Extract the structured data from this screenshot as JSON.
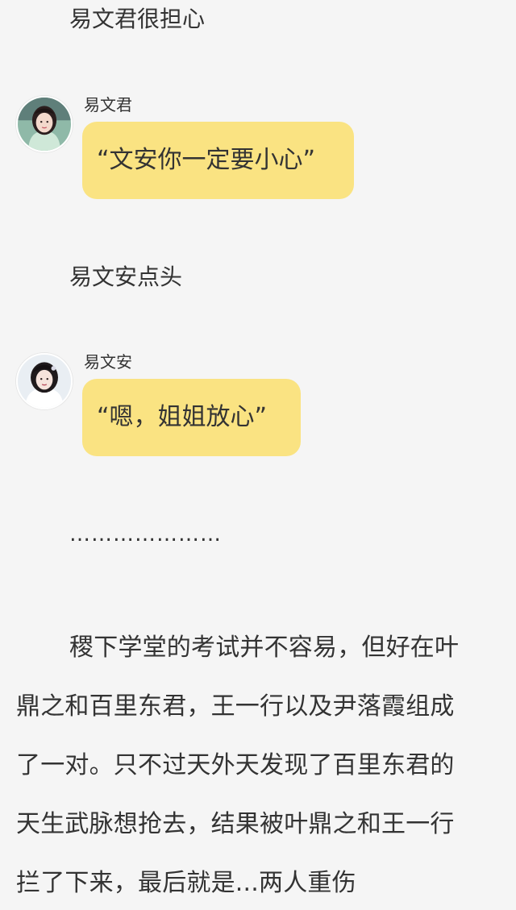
{
  "narration_top": "易文君很担心",
  "chat_1": {
    "avatar": "female-portrait-avatar",
    "speaker": "易文君",
    "message": "“文安你一定要小心”"
  },
  "narration_mid": "易文安点头",
  "chat_2": {
    "avatar": "female-portrait-avatar",
    "speaker": "易文安",
    "message": "“嗯，姐姐放心”"
  },
  "ellipsis": "…………………",
  "paragraph_lines": [
    "稷下学堂的考试并不容易，但好在叶",
    "鼎之和百里东君，王一行以及尹落霞组成",
    "了一对。只不过天外天发现了百里东君的",
    "天生武脉想抢去，结果被叶鼎之和王一行",
    "拦了下来，最后就是...两人重伤"
  ],
  "colors": {
    "background": "#f5f5f5",
    "bubble": "#fae382",
    "text": "#333333"
  }
}
